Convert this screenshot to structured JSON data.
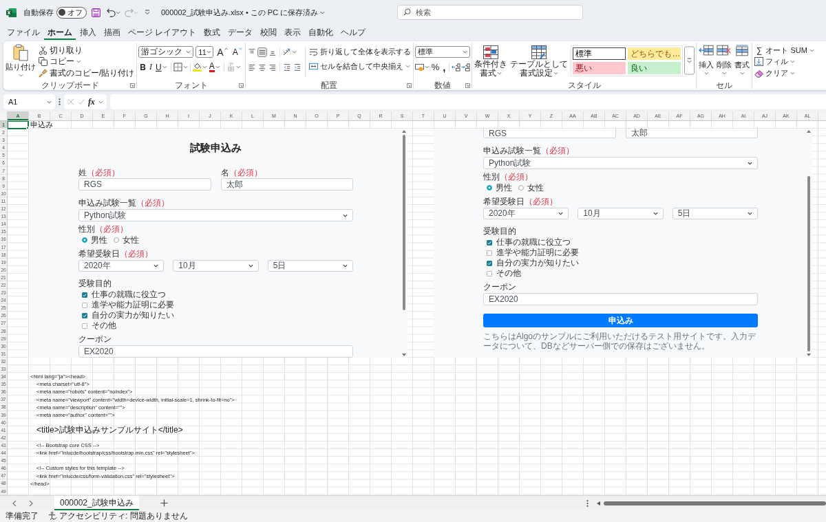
{
  "title_bar": {
    "autosave": {
      "label": "自動保存",
      "state": "オフ",
      "on": false
    },
    "filename": "000002_試験申込み.xlsx • この PC に保存済み",
    "search": {
      "placeholder": "検索"
    }
  },
  "menu_tabs": [
    {
      "label": "ファイル",
      "selected": false
    },
    {
      "label": "ホーム",
      "selected": true
    },
    {
      "label": "挿入",
      "selected": false
    },
    {
      "label": "描画",
      "selected": false
    },
    {
      "label": "ページ レイアウト",
      "selected": false
    },
    {
      "label": "数式",
      "selected": false
    },
    {
      "label": "データ",
      "selected": false
    },
    {
      "label": "校閲",
      "selected": false
    },
    {
      "label": "表示",
      "selected": false
    },
    {
      "label": "自動化",
      "selected": false
    },
    {
      "label": "ヘルプ",
      "selected": false
    }
  ],
  "ribbon": {
    "clipboard": {
      "label": "クリップボード",
      "paste": "貼り付け",
      "cut": "切り取り",
      "copy": "コピー",
      "format_painter": "書式のコピー/貼り付け"
    },
    "font": {
      "label": "フォント",
      "font_name": "游ゴシック",
      "font_size": "11",
      "grow": "A",
      "shrink": "A",
      "bold": "B",
      "italic": "I",
      "underline": "U",
      "font_color": "A"
    },
    "alignment": {
      "label": "配置",
      "vertical": [
        {
          "kind": "top",
          "selected": false
        },
        {
          "kind": "middle",
          "selected": true
        },
        {
          "kind": "bottom",
          "selected": false
        }
      ],
      "wrap_text": "折り返して全体を表示する",
      "merge_center": "セルを結合して中央揃え"
    },
    "number": {
      "label": "数値",
      "format": "標準",
      "percent": "%",
      "comma": ","
    },
    "styles": {
      "label": "スタイル",
      "conditional_format": [
        "条件付き",
        "書式"
      ],
      "format_as_table": [
        "テーブルとして",
        "書式設定"
      ],
      "gallery": [
        {
          "label": "標準",
          "kind": "normal",
          "color": "#ffffff",
          "selected": true
        },
        {
          "label": "どちらでも…",
          "kind": "neutral",
          "color": "#ffeb9c",
          "selected": false
        },
        {
          "label": "悪い",
          "kind": "bad",
          "color": "#ffc7ce",
          "selected": false
        },
        {
          "label": "良い",
          "kind": "good",
          "color": "#c6efce",
          "selected": false
        }
      ]
    },
    "cells": {
      "label": "セル",
      "insert": "挿入",
      "delete": "削除",
      "format": "書式"
    },
    "editing": {
      "autosum_symbol": "∑",
      "autosum": "オート SUM",
      "fill": "フィル",
      "clear": "クリア"
    }
  },
  "formula_bar": {
    "name_box": "A1",
    "function_button": "fx"
  },
  "sheet": {
    "columns": [
      {
        "label": "A",
        "selected": true
      },
      {
        "label": "B",
        "selected": false
      },
      {
        "label": "C",
        "selected": false
      },
      {
        "label": "D",
        "selected": false
      },
      {
        "label": "E",
        "selected": false
      },
      {
        "label": "F",
        "selected": false
      },
      {
        "label": "G",
        "selected": false
      },
      {
        "label": "H",
        "selected": false
      },
      {
        "label": "I",
        "selected": false
      },
      {
        "label": "J",
        "selected": false
      },
      {
        "label": "K",
        "selected": false
      },
      {
        "label": "L",
        "selected": false
      },
      {
        "label": "M",
        "selected": false
      },
      {
        "label": "N",
        "selected": false
      },
      {
        "label": "O",
        "selected": false
      },
      {
        "label": "P",
        "selected": false
      },
      {
        "label": "Q",
        "selected": false
      },
      {
        "label": "R",
        "selected": false
      },
      {
        "label": "S",
        "selected": false
      },
      {
        "label": "T",
        "selected": false
      },
      {
        "label": "U",
        "selected": false
      },
      {
        "label": "V",
        "selected": false
      },
      {
        "label": "W",
        "selected": false
      },
      {
        "label": "X",
        "selected": false
      },
      {
        "label": "Y",
        "selected": false
      },
      {
        "label": "Z",
        "selected": false
      },
      {
        "label": "AA",
        "selected": false
      },
      {
        "label": "AB",
        "selected": false
      },
      {
        "label": "AC",
        "selected": false
      },
      {
        "label": "AD",
        "selected": false
      },
      {
        "label": "AE",
        "selected": false
      },
      {
        "label": "AF",
        "selected": false
      },
      {
        "label": "AG",
        "selected": false
      },
      {
        "label": "AH",
        "selected": false
      },
      {
        "label": "AI",
        "selected": false
      },
      {
        "label": "AJ",
        "selected": false
      },
      {
        "label": "AK",
        "selected": false
      },
      {
        "label": "AL",
        "selected": false
      }
    ],
    "rows": [
      {
        "label": "1",
        "selected": true
      },
      {
        "label": "2",
        "selected": false
      },
      {
        "label": "3",
        "selected": false
      },
      {
        "label": "4",
        "selected": false
      },
      {
        "label": "5",
        "selected": false
      },
      {
        "label": "6",
        "selected": false
      },
      {
        "label": "7",
        "selected": false
      },
      {
        "label": "8",
        "selected": false
      },
      {
        "label": "9",
        "selected": false
      },
      {
        "label": "10",
        "selected": false
      },
      {
        "label": "11",
        "selected": false
      },
      {
        "label": "12",
        "selected": false
      },
      {
        "label": "13",
        "selected": false
      },
      {
        "label": "14",
        "selected": false
      },
      {
        "label": "15",
        "selected": false
      },
      {
        "label": "16",
        "selected": false
      },
      {
        "label": "17",
        "selected": false
      },
      {
        "label": "18",
        "selected": false
      },
      {
        "label": "19",
        "selected": false
      },
      {
        "label": "20",
        "selected": false
      },
      {
        "label": "21",
        "selected": false
      },
      {
        "label": "22",
        "selected": false
      },
      {
        "label": "23",
        "selected": false
      },
      {
        "label": "24",
        "selected": false
      },
      {
        "label": "25",
        "selected": false
      },
      {
        "label": "26",
        "selected": false
      },
      {
        "label": "27",
        "selected": false
      },
      {
        "label": "28",
        "selected": false
      },
      {
        "label": "29",
        "selected": false
      },
      {
        "label": "30",
        "selected": false
      },
      {
        "label": "31",
        "selected": false
      },
      {
        "label": "32",
        "selected": false
      },
      {
        "label": "33",
        "selected": false
      },
      {
        "label": "34",
        "selected": false
      },
      {
        "label": "35",
        "selected": false
      },
      {
        "label": "36",
        "selected": false
      },
      {
        "label": "37",
        "selected": false
      },
      {
        "label": "38",
        "selected": false
      },
      {
        "label": "39",
        "selected": false
      },
      {
        "label": "40",
        "selected": false
      },
      {
        "label": "41",
        "selected": false
      },
      {
        "label": "42",
        "selected": false
      },
      {
        "label": "43",
        "selected": false
      },
      {
        "label": "44",
        "selected": false
      },
      {
        "label": "45",
        "selected": false
      },
      {
        "label": "46",
        "selected": false
      },
      {
        "label": "47",
        "selected": false
      },
      {
        "label": "48",
        "selected": false
      },
      {
        "label": "49",
        "selected": false
      }
    ],
    "cell_b1": "申込み",
    "code_lines": [
      {
        "text": "<html lang=\"ja\"><head>",
        "child_groups": [
          [
            "<meta charset=\"utf-8\">",
            "<meta name=\"robots\" content=\"noindex\">",
            "<meta name=\"viewport\" content=\"width=device-width, initial-scale=1, shrink-to-fit=no\">",
            "<meta name=\"description\" content=\"\">",
            "<meta name=\"author\" content=\"\">"
          ],
          [
            "<title>試験申込みサンプルサイト</title>"
          ],
          [
            "<!-- Bootstrap core CSS -->",
            "<link href=\"inlucde/bootstrap/css/bootstrap.min.css\" rel=\"stylesheet\">"
          ],
          [
            "<!-- Custom styles for this template -->",
            "<link href=\"inlucde/css/form-validation.css\" rel=\"stylesheet\">"
          ]
        ]
      },
      {
        "text": "</head>"
      }
    ]
  },
  "pictures": [
    {
      "blocks": [
        {
          "kind": "title",
          "text": "試験申込み"
        },
        {
          "kind": "name_fields",
          "fields": [
            {
              "label": "姓",
              "required": "（必須）",
              "value": "RGS"
            },
            {
              "label": "名",
              "required": "（必須）",
              "value": "太郎"
            }
          ]
        },
        {
          "kind": "select",
          "label": "申込み試験一覧",
          "required": "（必須）",
          "value": "Python試験"
        },
        {
          "kind": "radios",
          "label": "性別",
          "required": "（必須）",
          "options": [
            {
              "label": "男性",
              "selected": true
            },
            {
              "label": "女性",
              "selected": false
            }
          ]
        },
        {
          "kind": "date_selects",
          "label": "希望受験日",
          "required": "（必須）",
          "values": [
            "2020年",
            "10月",
            "5日"
          ]
        },
        {
          "kind": "checkboxes",
          "label": "受験目的",
          "options": [
            {
              "label": "仕事の就職に役立つ",
              "checked": true
            },
            {
              "label": "進学や能力証明に必要",
              "checked": false
            },
            {
              "label": "自分の実力が知りたい",
              "checked": true
            },
            {
              "label": "その他",
              "checked": false
            }
          ]
        },
        {
          "kind": "input",
          "label": "クーポン",
          "value": "EX2020"
        }
      ]
    },
    {
      "blocks": [
        {
          "kind": "name_fields",
          "fields": [
            {
              "value": "RGS"
            },
            {
              "value": "太郎"
            }
          ]
        },
        {
          "kind": "select",
          "label": "申込み試験一覧",
          "required": "（必須）",
          "value": "Python試験"
        },
        {
          "kind": "radios",
          "label": "性別",
          "required": "（必須）",
          "options": [
            {
              "label": "男性",
              "selected": true
            },
            {
              "label": "女性",
              "selected": false
            }
          ]
        },
        {
          "kind": "date_selects",
          "label": "希望受験日",
          "required": "（必須）",
          "values": [
            "2020年",
            "10月",
            "5日"
          ]
        },
        {
          "kind": "checkboxes",
          "label": "受験目的",
          "options": [
            {
              "label": "仕事の就職に役立つ",
              "checked": true
            },
            {
              "label": "進学や能力証明に必要",
              "checked": false
            },
            {
              "label": "自分の実力が知りたい",
              "checked": true
            },
            {
              "label": "その他",
              "checked": false
            }
          ]
        },
        {
          "kind": "input",
          "label": "クーポン",
          "value": "EX2020"
        },
        {
          "kind": "button",
          "text": "申込み"
        },
        {
          "kind": "note",
          "text": "こちらはAlgoのサンプルにご利用いただけるテスト用サイトです。入力データについて、DBなどサーバー側での保存はございません。"
        }
      ]
    }
  ],
  "sheet_tabs": [
    {
      "label": "000002_試験申込み",
      "selected": true
    }
  ],
  "status_bar": {
    "ready": "準備完了",
    "accessibility": "アクセシビリティ: 問題ありません"
  }
}
